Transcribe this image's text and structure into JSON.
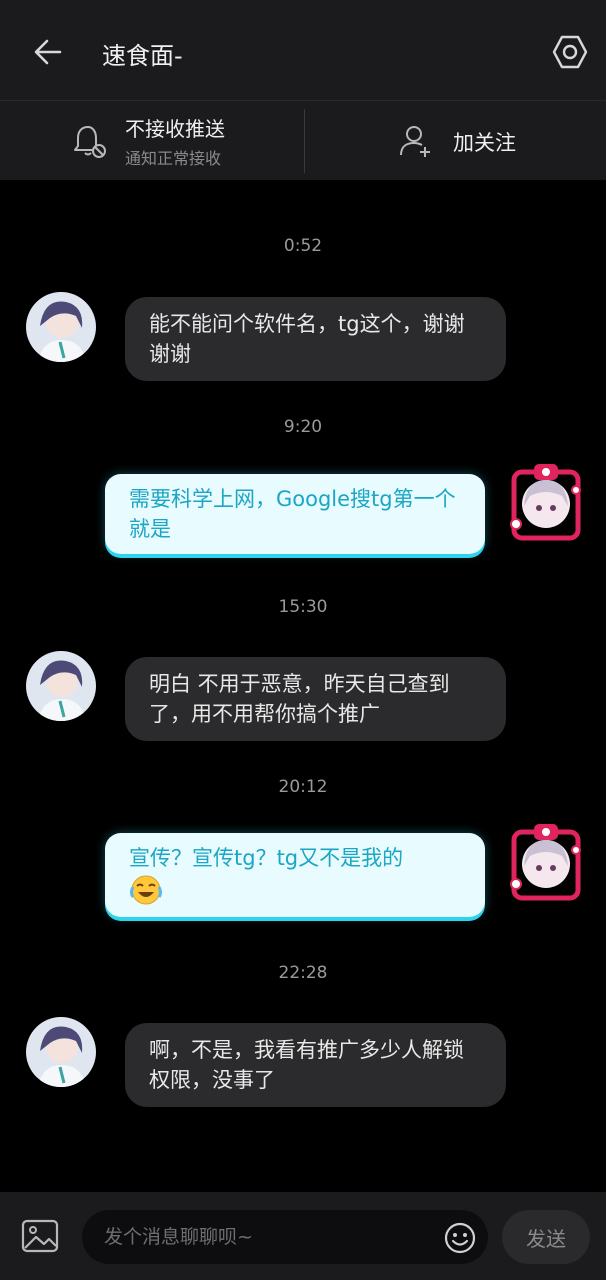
{
  "header": {
    "title": "速食面-"
  },
  "actions": {
    "push": {
      "title": "不接收推送",
      "subtitle": "通知正常接收"
    },
    "follow": {
      "label": "加关注"
    }
  },
  "messages": [
    {
      "time": "0:52",
      "side": "left",
      "text": "能不能问个软件名，tg这个，谢谢谢谢"
    },
    {
      "time": "9:20",
      "side": "right",
      "text": "需要科学上网，Google搜tg第一个就是"
    },
    {
      "time": "15:30",
      "side": "left",
      "text": "明白  不用于恶意，昨天自己查到了，用不用帮你搞个推广"
    },
    {
      "time": "20:12",
      "side": "right",
      "text": "宣传？宣传tg？tg又不是我的",
      "emoji": "laughing-tears-emoji"
    },
    {
      "time": "22:28",
      "side": "left",
      "text": "啊，不是，我看有推广多少人解锁权限，没事了"
    }
  ],
  "composer": {
    "placeholder": "发个消息聊聊呗~",
    "send_label": "发送"
  },
  "colors": {
    "background": "#000000",
    "bar": "#1b1b1d",
    "bubble_left": "#2b2b2d",
    "bubble_right": "#e8fbff",
    "accent": "#2fd3ee"
  }
}
